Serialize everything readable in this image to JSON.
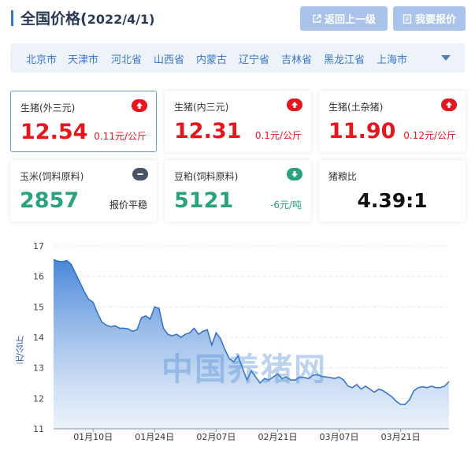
{
  "header": {
    "title_main": "全国价格(",
    "title_date": "2022/4/1)",
    "back_label": "返回上一级",
    "report_label": "我要报价"
  },
  "provinces": [
    "北京市",
    "天津市",
    "河北省",
    "山西省",
    "内蒙古",
    "辽宁省",
    "吉林省",
    "黑龙江省",
    "上海市"
  ],
  "cards": [
    {
      "name": "生猪(外三元)",
      "price": "12.54",
      "change": "0.11元/公斤",
      "trend": "up"
    },
    {
      "name": "生猪(内三元)",
      "price": "12.31",
      "change": "0.1元/公斤",
      "trend": "up"
    },
    {
      "name": "生猪(土杂猪)",
      "price": "11.90",
      "change": "0.12元/公斤",
      "trend": "up"
    },
    {
      "name": "玉米(饲料原料)",
      "price": "2857",
      "change": "报价平稳",
      "trend": "flat"
    },
    {
      "name": "豆粕(饲料原料)",
      "price": "5121",
      "change": "-6元/吨",
      "trend": "down"
    },
    {
      "name": "猪粮比",
      "price": "4.39:1",
      "change": "",
      "trend": "none"
    }
  ],
  "colors": {
    "accent": "#3a78c8",
    "up": "#e5161d",
    "down": "#2aa27e",
    "flat": "#4a5468"
  },
  "chart_data": {
    "type": "area",
    "ylabel": "元/公斤",
    "ylim": [
      11,
      17
    ],
    "yticks": [
      11,
      12,
      13,
      14,
      15,
      16,
      17
    ],
    "xticks": [
      "01月10日",
      "01月24日",
      "02月07日",
      "02月21日",
      "03月07日",
      "03月21日"
    ],
    "grid": true,
    "watermark": "中国养猪网",
    "x": [
      "01-01",
      "01-02",
      "01-03",
      "01-04",
      "01-05",
      "01-06",
      "01-07",
      "01-08",
      "01-09",
      "01-10",
      "01-11",
      "01-12",
      "01-13",
      "01-14",
      "01-15",
      "01-16",
      "01-17",
      "01-18",
      "01-19",
      "01-20",
      "01-21",
      "01-22",
      "01-23",
      "01-24",
      "01-25",
      "01-26",
      "01-27",
      "01-28",
      "01-29",
      "01-30",
      "01-31",
      "02-01",
      "02-02",
      "02-03",
      "02-04",
      "02-05",
      "02-06",
      "02-07",
      "02-08",
      "02-09",
      "02-10",
      "02-11",
      "02-12",
      "02-13",
      "02-14",
      "02-15",
      "02-16",
      "02-17",
      "02-18",
      "02-19",
      "02-20",
      "02-21",
      "02-22",
      "02-23",
      "02-24",
      "02-25",
      "02-26",
      "02-27",
      "02-28",
      "03-01",
      "03-02",
      "03-03",
      "03-04",
      "03-05",
      "03-06",
      "03-07",
      "03-08",
      "03-09",
      "03-10",
      "03-11",
      "03-12",
      "03-13",
      "03-14",
      "03-15",
      "03-16",
      "03-17",
      "03-18",
      "03-19",
      "03-20",
      "03-21",
      "03-22",
      "03-23",
      "03-24",
      "03-25",
      "03-26",
      "03-27",
      "03-28",
      "03-29",
      "03-30",
      "03-31",
      "04-01"
    ],
    "series": [
      {
        "values": [
          16.55,
          16.5,
          16.48,
          16.52,
          16.4,
          16.1,
          15.8,
          15.5,
          15.25,
          15.15,
          14.8,
          14.5,
          14.4,
          14.35,
          14.38,
          14.3,
          14.3,
          14.28,
          14.2,
          14.25,
          14.65,
          14.7,
          14.6,
          15.0,
          14.95,
          14.3,
          14.1,
          14.05,
          14.1,
          14.0,
          14.1,
          14.15,
          14.3,
          14.1,
          14.2,
          14.25,
          13.75,
          14.15,
          13.95,
          13.6,
          13.3,
          13.2,
          13.4,
          13.0,
          12.6,
          12.9,
          12.7,
          12.5,
          12.65,
          12.6,
          12.7,
          12.8,
          12.65,
          12.7,
          12.6,
          12.6,
          12.7,
          12.68,
          12.65,
          12.75,
          12.78,
          12.72,
          12.7,
          12.68,
          12.65,
          12.7,
          12.6,
          12.4,
          12.35,
          12.45,
          12.3,
          12.4,
          12.3,
          12.2,
          12.3,
          12.25,
          12.15,
          12.05,
          11.9,
          11.8,
          11.8,
          11.95,
          12.25,
          12.35,
          12.38,
          12.35,
          12.4,
          12.35,
          12.35,
          12.4,
          12.55
        ]
      }
    ]
  }
}
